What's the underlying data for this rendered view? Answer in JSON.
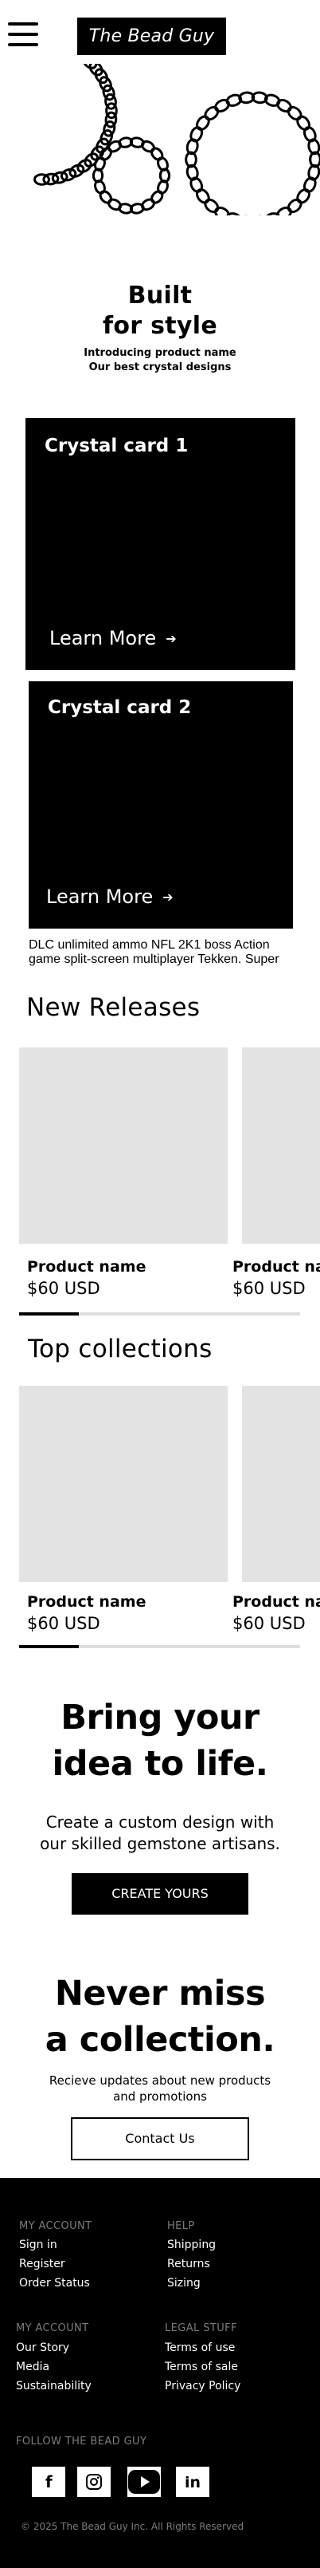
{
  "header": {
    "menu_icon": "hamburger-menu-icon",
    "logo_text": "The Bead Guy"
  },
  "hero": {
    "title_line1": "Built",
    "title_line2": "for style",
    "subtitle_line1": "Introducing product name",
    "subtitle_line2": "Our best crystal designs",
    "art": "bead-chain-rings"
  },
  "cards": [
    {
      "title": "Crystal card 1",
      "link_label": "Learn More"
    },
    {
      "title": "Crystal card 2",
      "link_label": "Learn More"
    }
  ],
  "card_description": "DLC unlimited ammo NFL 2K1 boss Action game split-screen multiplayer Tekken. Super",
  "new_releases": {
    "title": "New Releases",
    "products": [
      {
        "name": "Product name",
        "price": "$60 USD"
      },
      {
        "name": "Product name",
        "price": "$60 USD"
      }
    ]
  },
  "top_collections": {
    "title": "Top collections",
    "products": [
      {
        "name": "Product name",
        "price": "$60 USD"
      },
      {
        "name": "Product name",
        "price": "$60 USD"
      }
    ]
  },
  "custom_design": {
    "title_line1": "Bring your",
    "title_line2": "idea to life.",
    "text_line1": "Create a custom design with",
    "text_line2": "our skilled gemstone artisans.",
    "button_label": "CREATE YOURS"
  },
  "newsletter": {
    "title_line1": "Never miss",
    "title_line2": "a collection.",
    "text_line1": "Recieve updates about new products",
    "text_line2": "and promotions",
    "button_label": "Contact Us"
  },
  "footer": {
    "col1_heading": "MY ACCOUNT",
    "col1_links": [
      "Sign in",
      "Register",
      "Order Status"
    ],
    "col2_heading": "HELP",
    "col2_links": [
      "Shipping",
      "Returns",
      "Sizing"
    ],
    "col3_heading": "MY ACCOUNT",
    "col3_links": [
      "Our Story",
      "Media",
      "Sustainability"
    ],
    "col4_heading": "LEGAL STUFF",
    "col4_links": [
      "Terms of use",
      "Terms of sale",
      "Privacy Policy"
    ],
    "follow_heading": "FOLLOW THE BEAD GUY",
    "social_icons": [
      "facebook-icon",
      "instagram-icon",
      "youtube-icon",
      "linkedin-icon"
    ],
    "copyright": "© 2025 The Bead Guy Inc. All Rights Reserved"
  },
  "colors": {
    "primary": "#000000",
    "background": "#ffffff",
    "placeholder": "#e3e3e3",
    "muted_text": "#7c7c7c"
  }
}
